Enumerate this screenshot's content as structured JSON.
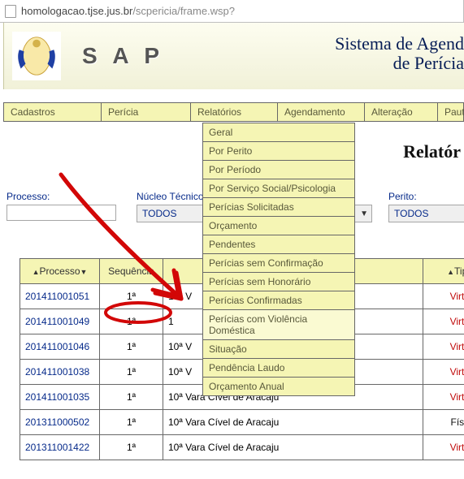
{
  "url": {
    "host": "homologacao.tjse.jus.br",
    "path": "/scpericia/frame.wsp?"
  },
  "banner": {
    "brand": "S A P",
    "line1": "Sistema de Agend",
    "line2": "de Perícia"
  },
  "menu": {
    "cadastros": "Cadastros",
    "pericia": "Perícia",
    "relatorios": "Relatórios",
    "agendamento": "Agendamento",
    "alteracao": "Alteração",
    "pauta": "Pauta"
  },
  "dropdown": [
    "Geral",
    "Por Perito",
    "Por Período",
    "Por Serviço Social/Psicologia",
    "Perícias Solicitadas",
    "Orçamento",
    "Pendentes",
    "Perícias sem Confirmação",
    "Perícias sem Honorário",
    "Perícias Confirmadas",
    "Perícias com Violência Doméstica",
    "Situação",
    "Pendência Laudo",
    "Orçamento Anual"
  ],
  "page_title": "Relatór",
  "filters": {
    "processo_label": "Processo:",
    "processo_value": "",
    "nucleo_label": "Núcleo Técnico",
    "nucleo_value": "TODOS",
    "perito_label": "Perito:",
    "perito_value": "TODOS"
  },
  "columns": {
    "processo": "Processo",
    "sequencia": "Sequência",
    "vara": "",
    "tipo": "Tipo"
  },
  "rows": [
    {
      "processo": "201411001051",
      "seq": "1ª",
      "vara": "10ª V",
      "tipo": "Virtual",
      "tipo_class": "virtual"
    },
    {
      "processo": "201411001049",
      "seq": "1ª",
      "vara": "1",
      "tipo": "Virtual",
      "tipo_class": "virtual"
    },
    {
      "processo": "201411001046",
      "seq": "1ª",
      "vara": "10ª V",
      "tipo": "Virtual",
      "tipo_class": "virtual"
    },
    {
      "processo": "201411001038",
      "seq": "1ª",
      "vara": "10ª V",
      "tipo": "Virtual",
      "tipo_class": "virtual"
    },
    {
      "processo": "201411001035",
      "seq": "1ª",
      "vara": "10ª Vara Cível de Aracaju",
      "tipo": "Virtual",
      "tipo_class": "virtual"
    },
    {
      "processo": "201311000502",
      "seq": "1ª",
      "vara": "10ª Vara Cível de Aracaju",
      "tipo": "Físico",
      "tipo_class": "fisico"
    },
    {
      "processo": "201311001422",
      "seq": "1ª",
      "vara": "10ª Vara Cível de Aracaju",
      "tipo": "Virtual",
      "tipo_class": "virtual"
    }
  ]
}
